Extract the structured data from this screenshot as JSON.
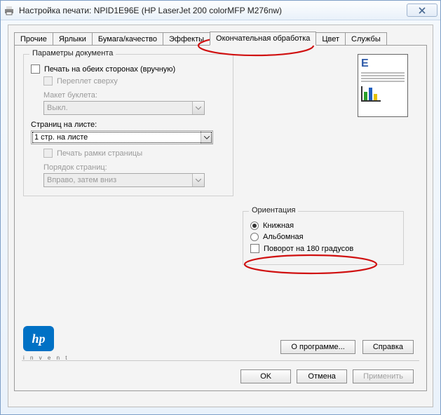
{
  "title": "Настройка печати: NPID1E96E (HP LaserJet 200 colorMFP M276nw)",
  "tabs": [
    "Прочие",
    "Ярлыки",
    "Бумага/качество",
    "Эффекты",
    "Окончательная обработка",
    "Цвет",
    "Службы"
  ],
  "active_tab": 4,
  "doc_params": {
    "title": "Параметры документа",
    "duplex_label": "Печать на обеих сторонах (вручную)",
    "flip_top_label": "Переплет сверху",
    "booklet_label": "Макет буклета:",
    "booklet_value": "Выкл.",
    "pages_per_sheet_label": "Страниц на листе:",
    "pages_per_sheet_value": "1 стр. на листе",
    "print_borders_label": "Печать рамки страницы",
    "page_order_label": "Порядок страниц:",
    "page_order_value": "Вправо, затем вниз"
  },
  "orientation": {
    "title": "Ориентация",
    "portrait": "Книжная",
    "landscape": "Альбомная",
    "rotate180": "Поворот на 180 градусов"
  },
  "logo_sub": "i n v e n t",
  "buttons": {
    "about": "О программе...",
    "help": "Справка",
    "ok": "OK",
    "cancel": "Отмена",
    "apply": "Применить"
  }
}
